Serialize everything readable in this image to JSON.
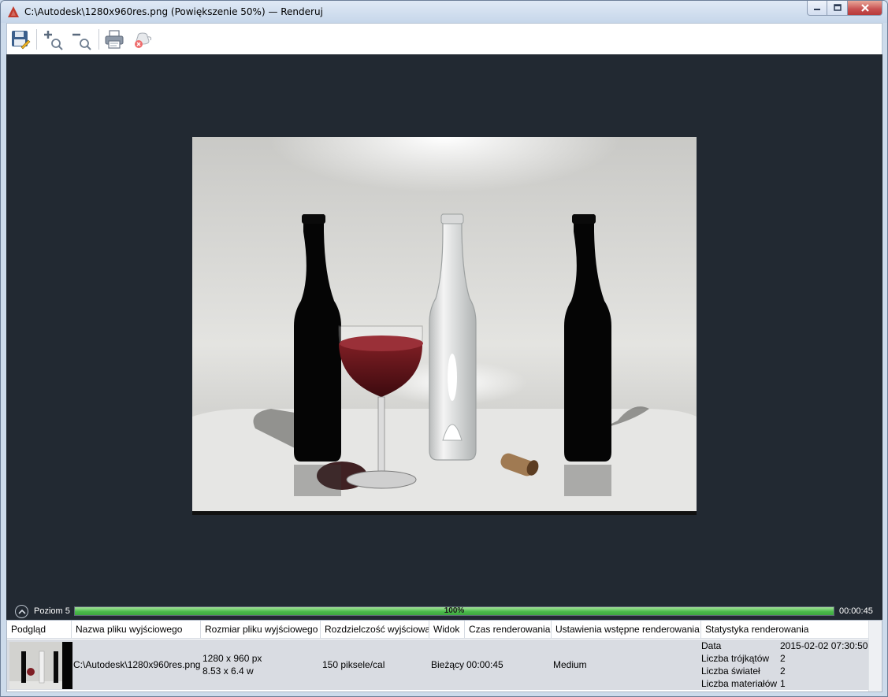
{
  "window": {
    "title": "C:\\Autodesk\\1280x960res.png (Powiększenie 50%) — Renderuj",
    "accent_color": "#c0392b"
  },
  "toolbar": {
    "buttons": [
      {
        "icon": "save-icon"
      },
      {
        "icon": "zoom-in-icon"
      },
      {
        "icon": "zoom-out-icon"
      },
      {
        "icon": "print-icon"
      },
      {
        "icon": "cancel-render-icon"
      }
    ]
  },
  "status": {
    "level_label": "Poziom 5",
    "progress_text": "100%",
    "progress_fraction": 1.0,
    "elapsed": "00:00:45",
    "progress_color": "#4bbb4b"
  },
  "history": {
    "columns": [
      "Podgląd",
      "Nazwa pliku wyjściowego",
      "Rozmiar pliku wyjściowego",
      "Rozdzielczość wyjściowa",
      "Widok",
      "Czas renderowania",
      "Ustawienia wstępne renderowania",
      "Statystyka renderowania"
    ],
    "row": {
      "file_name": "C:\\Autodesk\\1280x960res.png",
      "size_px": "1280 x 960 px",
      "size_in": "8.53 x 6.4 w",
      "resolution": "150 piksele/cal",
      "view": "Bieżący",
      "render_time": "00:00:45",
      "preset": "Medium",
      "stats": [
        {
          "label": "Data",
          "value": "2015-02-02 07:30:50"
        },
        {
          "label": "Liczba trójkątów",
          "value": "2"
        },
        {
          "label": "Liczba świateł",
          "value": "2"
        },
        {
          "label": "Liczba materiałów",
          "value": "1"
        }
      ]
    }
  }
}
